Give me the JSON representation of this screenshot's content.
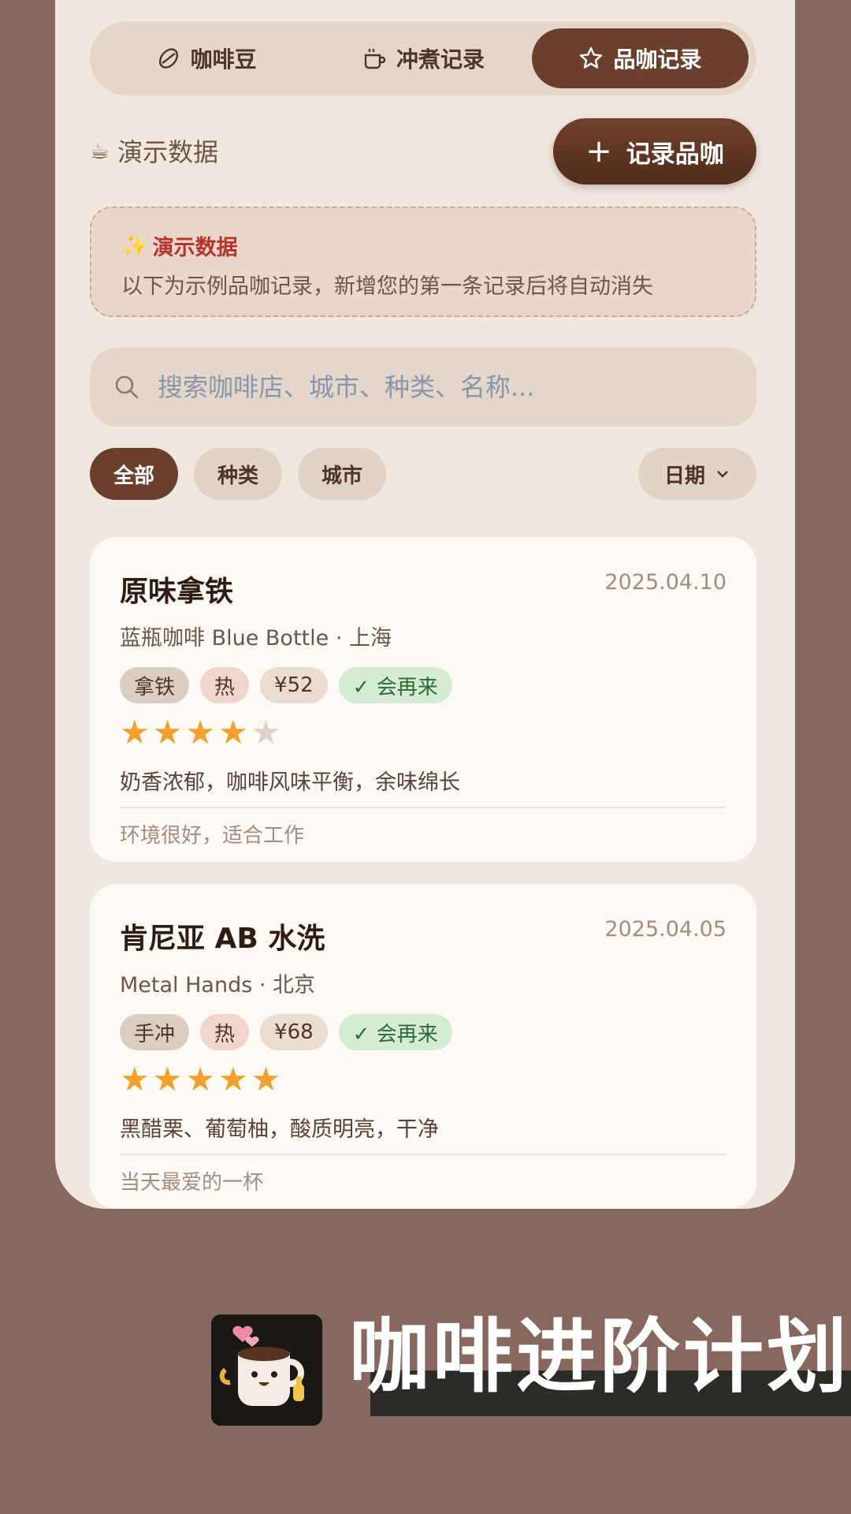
{
  "tabs": [
    {
      "label": "咖啡豆",
      "icon": "bean-icon",
      "active": false
    },
    {
      "label": "冲煮记录",
      "icon": "coffee-cup-icon",
      "active": false
    },
    {
      "label": "品咖记录",
      "icon": "star-icon",
      "active": true
    }
  ],
  "toolbar": {
    "demo_label": "演示数据",
    "demo_icon": "☕",
    "add_label": "记录品咖"
  },
  "notice": {
    "icon": "✨",
    "title": "演示数据",
    "text": "以下为示例品咖记录，新增您的第一条记录后将自动消失"
  },
  "search": {
    "placeholder": "搜索咖啡店、城市、种类、名称..."
  },
  "filters": {
    "all": "全部",
    "kind": "种类",
    "city": "城市",
    "sort": "日期"
  },
  "records": [
    {
      "title": "原味拿铁",
      "date": "2025.04.10",
      "shop": "蓝瓶咖啡 Blue Bottle · 上海",
      "kind": "拿铁",
      "temp": "热",
      "price": "¥52",
      "again": "✓ 会再来",
      "rating": 4,
      "flavor": "奶香浓郁，咖啡风味平衡，余味绵长",
      "note": "环境很好，适合工作"
    },
    {
      "title": "肯尼亚 AB 水洗",
      "date": "2025.04.05",
      "shop": "Metal Hands · 北京",
      "kind": "手冲",
      "temp": "热",
      "price": "¥68",
      "again": "✓ 会再来",
      "rating": 5,
      "flavor": "黑醋栗、葡萄柚，酸质明亮，干净",
      "note": "当天最爱的一杯"
    }
  ],
  "brand": {
    "name": "咖啡进阶计划"
  },
  "colors": {
    "accent": "#6b3f2c",
    "star": "#f0a02c",
    "again": "#2f6b34",
    "background": "#88685e"
  }
}
